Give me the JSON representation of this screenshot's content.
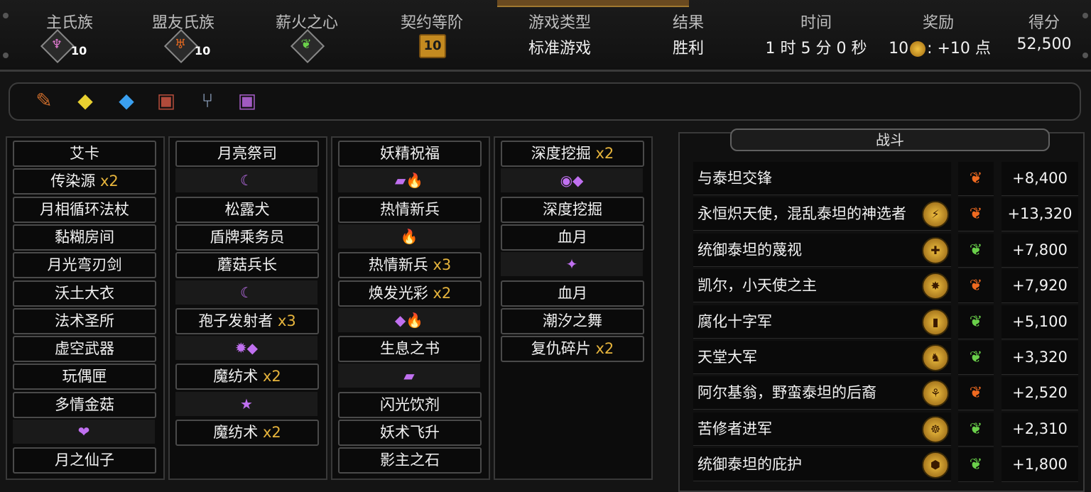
{
  "header": {
    "labels": [
      "主氏族",
      "盟友氏族",
      "薪火之心",
      "契约等阶",
      "游戏类型",
      "结果",
      "时间",
      "奖励",
      "得分"
    ],
    "main_clan_level": "10",
    "allied_clan_level": "10",
    "covenant_level": "10",
    "game_type": "标准游戏",
    "result": "胜利",
    "time": "1 时 5 分 0 秒",
    "reward_count": "10",
    "reward_points": ": +10 点",
    "score": "52,500"
  },
  "items": [
    "musket-icon",
    "yellow-crystal-icon",
    "blue-crystal-icon",
    "red-chest-icon",
    "fork-icon",
    "purple-chest-icon"
  ],
  "deck": {
    "col1": [
      {
        "name": "艾卡",
        "mult": ""
      },
      {
        "name": "传染源",
        "mult": "x2"
      },
      {
        "name": "月相循环法杖",
        "mult": ""
      },
      {
        "name": "黏糊房间",
        "mult": ""
      },
      {
        "name": "月光弯刃剑",
        "mult": ""
      },
      {
        "name": "沃土大衣",
        "mult": ""
      },
      {
        "name": "法术圣所",
        "mult": ""
      },
      {
        "name": "虚空武器",
        "mult": ""
      },
      {
        "name": "玩偶匣",
        "mult": ""
      },
      {
        "name": "多情金菇",
        "mult": ""
      },
      {
        "icons": "❤"
      },
      {
        "name": "月之仙子",
        "mult": ""
      }
    ],
    "col2": [
      {
        "name": "月亮祭司",
        "mult": ""
      },
      {
        "icons": "☾"
      },
      {
        "name": "松露犬",
        "mult": ""
      },
      {
        "name": "盾牌乘务员",
        "mult": ""
      },
      {
        "name": "蘑菇兵长",
        "mult": ""
      },
      {
        "icons": "☾"
      },
      {
        "name": "孢子发射者",
        "mult": "x3"
      },
      {
        "icons": "✹◆"
      },
      {
        "name": "魔纺术",
        "mult": "x2"
      },
      {
        "icons": "★"
      },
      {
        "name": "魔纺术",
        "mult": "x2"
      }
    ],
    "col3": [
      {
        "name": "妖精祝福",
        "mult": ""
      },
      {
        "icons": "▰🔥"
      },
      {
        "name": "热情新兵",
        "mult": ""
      },
      {
        "icons": "🔥"
      },
      {
        "name": "热情新兵",
        "mult": "x3"
      },
      {
        "name": "焕发光彩",
        "mult": "x2"
      },
      {
        "icons": "◆🔥"
      },
      {
        "name": "生息之书",
        "mult": ""
      },
      {
        "icons": "▰"
      },
      {
        "name": "闪光饮剂",
        "mult": ""
      },
      {
        "name": "妖术飞升",
        "mult": ""
      },
      {
        "name": "影主之石",
        "mult": ""
      }
    ],
    "col4": [
      {
        "name": "深度挖掘",
        "mult": "x2"
      },
      {
        "icons": "◉◆"
      },
      {
        "name": "深度挖掘",
        "mult": ""
      },
      {
        "name": "血月",
        "mult": ""
      },
      {
        "icons": "✦"
      },
      {
        "name": "血月",
        "mult": ""
      },
      {
        "name": "潮汐之舞",
        "mult": ""
      },
      {
        "name": "复仇碎片",
        "mult": "x2"
      }
    ]
  },
  "battle": {
    "title": "战斗",
    "rows": [
      {
        "name": "与泰坦交锋",
        "badge": "",
        "score": "+8,400",
        "hot": true
      },
      {
        "name": "永恒炽天使，混乱泰坦的神选者",
        "badge": "⚡",
        "score": "+13,320",
        "hot": true
      },
      {
        "name": "统御泰坦的蔑视",
        "badge": "✚",
        "score": "+7,800",
        "hot": false
      },
      {
        "name": "凯尔，小天使之主",
        "badge": "✸",
        "score": "+7,920",
        "hot": true
      },
      {
        "name": "腐化十字军",
        "badge": "▮",
        "score": "+5,100",
        "hot": false
      },
      {
        "name": "天堂大军",
        "badge": "♞",
        "score": "+3,320",
        "hot": false
      },
      {
        "name": "阿尔基翁，野蛮泰坦的后裔",
        "badge": "⚘",
        "score": "+2,520",
        "hot": true
      },
      {
        "name": "苦修者进军",
        "badge": "☸",
        "score": "+2,310",
        "hot": false
      },
      {
        "name": "统御泰坦的庇护",
        "badge": "⬢",
        "score": "+1,800",
        "hot": false
      }
    ]
  },
  "colors": {
    "accent": "#e6b43c",
    "panel_border": "#4a4a4a"
  }
}
